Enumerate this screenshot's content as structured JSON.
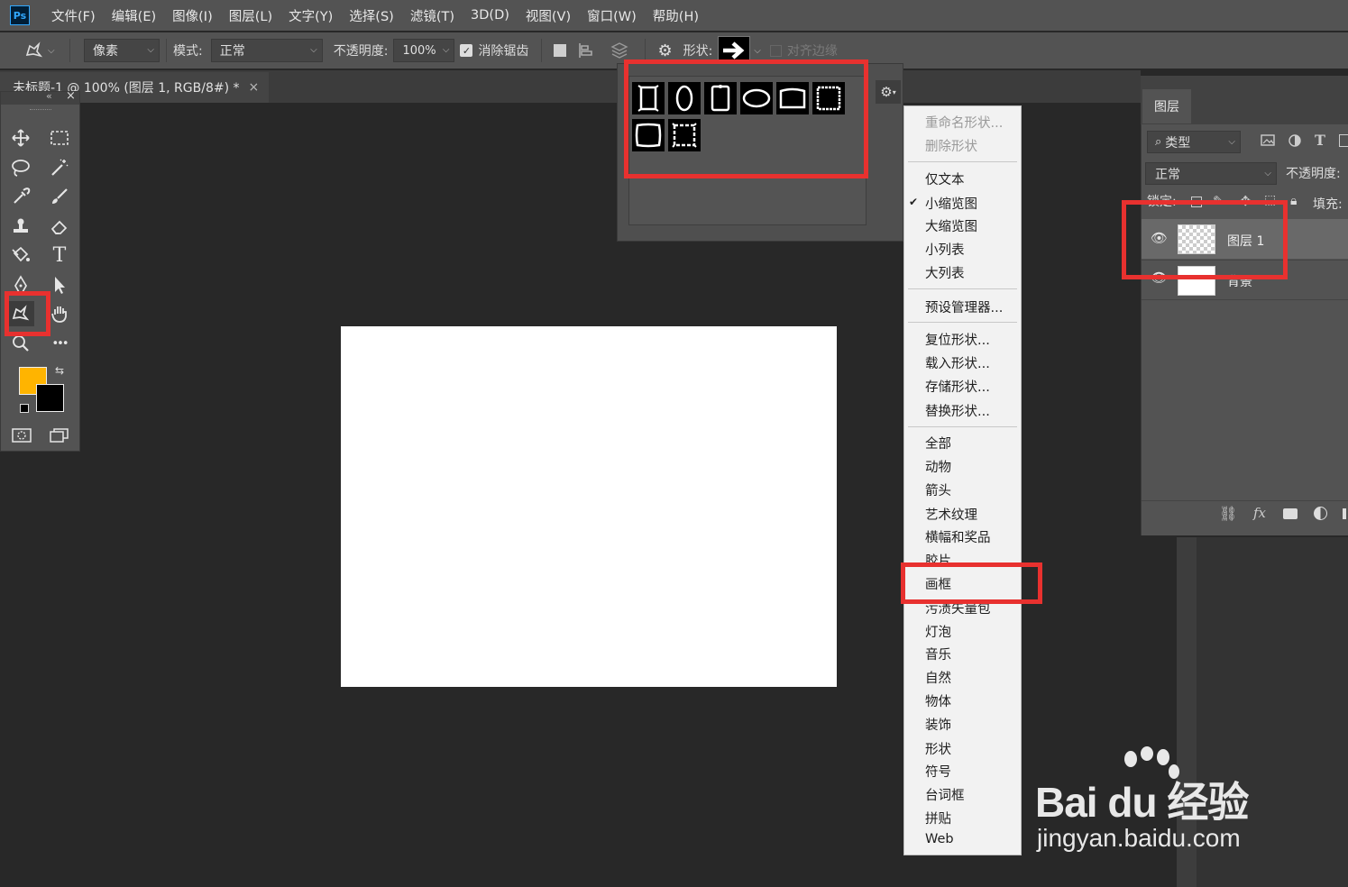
{
  "app": {
    "logo": "Ps"
  },
  "menubar": {
    "items": [
      "文件(F)",
      "编辑(E)",
      "图像(I)",
      "图层(L)",
      "文字(Y)",
      "选择(S)",
      "滤镜(T)",
      "3D(D)",
      "视图(V)",
      "窗口(W)",
      "帮助(H)"
    ]
  },
  "options": {
    "tool_mode": "像素",
    "mode_label": "模式:",
    "mode_value": "正常",
    "opacity_label": "不透明度:",
    "opacity_value": "100%",
    "antialias_label": "消除锯齿",
    "shape_label": "形状:",
    "align_edges_label": "对齐边缘"
  },
  "document_tab": {
    "title": "未标题-1 @ 100% (图层 1, RGB/8#) *",
    "close": "×"
  },
  "toolbar": {
    "collapse": "«",
    "close": "×",
    "type_tool_glyph": "T",
    "more_glyph": "•••"
  },
  "colors": {
    "foreground": "#ffb400",
    "background": "#000000",
    "highlight": "#e8312f",
    "panel": "#535353",
    "canvas_bg": "#282828"
  },
  "shape_picker": {
    "thumbnails": [
      "frame-1",
      "frame-2",
      "frame-3",
      "frame-4",
      "frame-5",
      "frame-6",
      "frame-7",
      "frame-8"
    ]
  },
  "context_menu": {
    "group1": [
      "重命名形状...",
      "删除形状"
    ],
    "group2": [
      "仅文本",
      "小缩览图",
      "大缩览图",
      "小列表",
      "大列表"
    ],
    "checked": "小缩览图",
    "group3": [
      "预设管理器..."
    ],
    "group4": [
      "复位形状...",
      "载入形状...",
      "存储形状...",
      "替换形状..."
    ],
    "group5": [
      "全部",
      "动物",
      "箭头",
      "艺术纹理",
      "横幅和奖品",
      "胶片",
      "画框",
      "污渍矢量包",
      "灯泡",
      "音乐",
      "自然",
      "物体",
      "装饰",
      "形状",
      "符号",
      "台词框",
      "拼贴",
      "Web"
    ]
  },
  "layers_panel": {
    "tab": "图层",
    "filter_label": "类型",
    "blend_mode": "正常",
    "opacity_label": "不透明度:",
    "lock_label": "锁定:",
    "fill_label": "填充:",
    "layers": [
      {
        "name": "图层 1",
        "visible": true,
        "selected": true
      },
      {
        "name": "背景",
        "visible": true,
        "selected": false
      }
    ],
    "footer_fx": "fx"
  },
  "watermark": {
    "brand": "Bai du 经验",
    "url": "jingyan.baidu.com"
  }
}
